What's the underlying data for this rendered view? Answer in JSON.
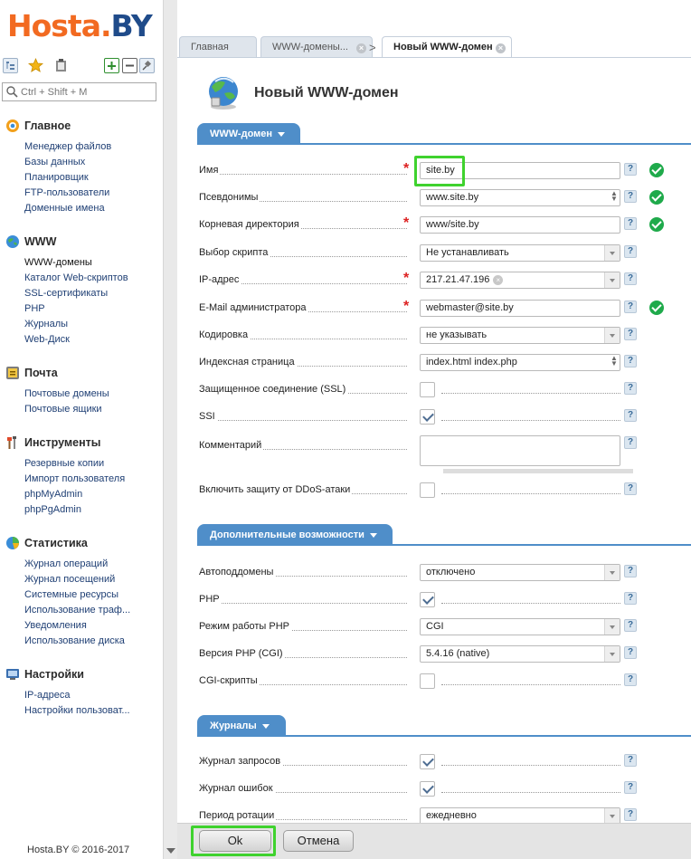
{
  "logo": {
    "part1": "Hosta.",
    "part2": "BY"
  },
  "search": {
    "placeholder": "Ctrl + Shift + M"
  },
  "sidebar": {
    "sections": [
      {
        "title": "Главное",
        "icon": "home-icon",
        "items": [
          "Менеджер файлов",
          "Базы данных",
          "Планировщик",
          "FTP-пользователи",
          "Доменные имена"
        ]
      },
      {
        "title": "WWW",
        "icon": "globe-icon",
        "items": [
          "WWW-домены",
          "Каталог Web-скриптов",
          "SSL-сертификаты",
          "PHP",
          "Журналы",
          "Web-Диск"
        ]
      },
      {
        "title": "Почта",
        "icon": "mail-icon",
        "items": [
          "Почтовые домены",
          "Почтовые ящики"
        ]
      },
      {
        "title": "Инструменты",
        "icon": "tools-icon",
        "items": [
          "Резервные копии",
          "Импорт пользователя",
          "phpMyAdmin",
          "phpPgAdmin"
        ]
      },
      {
        "title": "Статистика",
        "icon": "pie-chart-icon",
        "items": [
          "Журнал операций",
          "Журнал посещений",
          "Системные ресурсы",
          "Использование траф...",
          "Уведомления",
          "Использование диска"
        ]
      },
      {
        "title": "Настройки",
        "icon": "settings-icon",
        "items": [
          "IP-адреса",
          "Настройки пользоват..."
        ]
      }
    ],
    "active_item": "WWW-домены"
  },
  "copyright": "Hosta.BY © 2016-2017",
  "tabs": [
    {
      "label": "Главная",
      "closable": false
    },
    {
      "label": "WWW-домены...",
      "closable": true
    },
    {
      "label": "Новый WWW-домен",
      "closable": true,
      "active": true
    }
  ],
  "page": {
    "title": "Новый WWW-домен"
  },
  "groups": {
    "domain": {
      "title": "WWW-домен"
    },
    "extra": {
      "title": "Дополнительные возможности"
    },
    "logs": {
      "title": "Журналы"
    }
  },
  "form": {
    "name": {
      "label": "Имя",
      "value": "site.by"
    },
    "aliases": {
      "label": "Псевдонимы",
      "value": "www.site.by"
    },
    "root_dir": {
      "label": "Корневая директория",
      "value": "www/site.by"
    },
    "script": {
      "label": "Выбор скрипта",
      "value": "Не устанавливать"
    },
    "ip": {
      "label": "IP-адрес",
      "value": "217.21.47.196"
    },
    "email": {
      "label": "E-Mail администратора",
      "value": "webmaster@site.by"
    },
    "encoding": {
      "label": "Кодировка",
      "value": "не указывать"
    },
    "index_page": {
      "label": "Индексная страница",
      "value": "index.html index.php"
    },
    "ssl": {
      "label": "Защищенное соединение (SSL)",
      "checked": false
    },
    "ssi": {
      "label": "SSI",
      "checked": true
    },
    "comment": {
      "label": "Комментарий",
      "value": ""
    },
    "ddos": {
      "label": "Включить защиту от DDoS-атаки",
      "checked": false
    },
    "autosub": {
      "label": "Автоподдомены",
      "value": "отключено"
    },
    "php": {
      "label": "PHP",
      "checked": true
    },
    "php_mode": {
      "label": "Режим работы PHP",
      "value": "CGI"
    },
    "php_version": {
      "label": "Версия PHP (CGI)",
      "value": "5.4.16 (native)"
    },
    "cgi": {
      "label": "CGI-скрипты",
      "checked": false
    },
    "access_log": {
      "label": "Журнал запросов",
      "checked": true
    },
    "error_log": {
      "label": "Журнал ошибок",
      "checked": true
    },
    "rotation": {
      "label": "Период ротации",
      "value": "ежедневно"
    }
  },
  "buttons": {
    "ok": "Ok",
    "cancel": "Отмена"
  },
  "colors": {
    "accent": "#4f8ec9",
    "brand_orange": "#f26a21",
    "brand_blue": "#1f4b8a",
    "valid": "#1faa4b",
    "highlight": "#3fd22e"
  }
}
